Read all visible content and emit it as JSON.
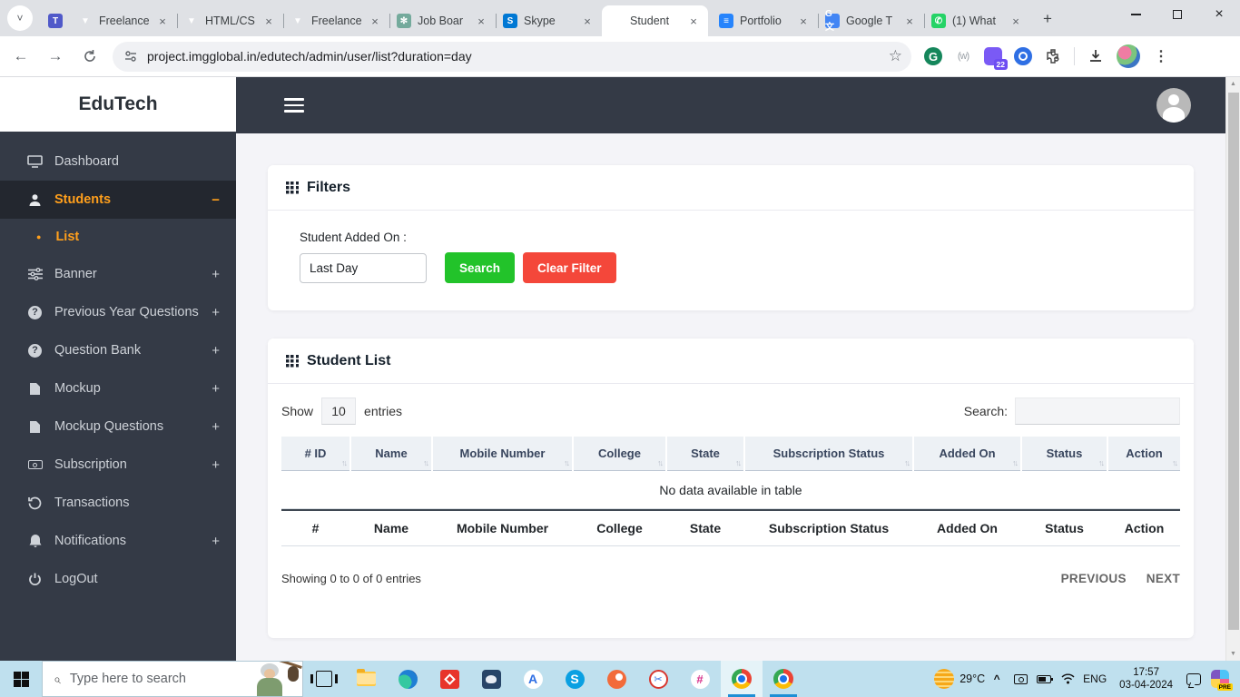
{
  "glyphs": {
    "close": "×",
    "plus": "+",
    "minus": "−",
    "back": "←",
    "forward": "→",
    "menu_dots": "⋮",
    "sort": "↑↓",
    "star": "☆",
    "chevron_down": "˅",
    "chevron_up": "^",
    "scroll_up": "▲",
    "scroll_down": "▼",
    "dot": "●",
    "magnifier": "⌕",
    "scissors": "✂",
    "hash": "#",
    "question": "?",
    "letter_g": "G",
    "letter_s": "S",
    "letter_a": "A",
    "translate_glyph": "G文",
    "wave": "(w)",
    "globe": "◍",
    "newtab": "+"
  },
  "browser": {
    "tabs": [
      {
        "label": "Freelance"
      },
      {
        "label": "HTML/CS"
      },
      {
        "label": "Freelance"
      },
      {
        "label": "Job Boar"
      },
      {
        "label": "Skype"
      },
      {
        "label": "Student"
      },
      {
        "label": "Portfolio"
      },
      {
        "label": "Google T"
      },
      {
        "label": "(1) What"
      }
    ],
    "url": "project.imgglobal.in/edutech/admin/user/list?duration=day",
    "extension_badge": "22"
  },
  "sidebar": {
    "brand": "EduTech",
    "items": [
      {
        "label": "Dashboard",
        "expander": ""
      },
      {
        "label": "Students",
        "expander": "−"
      },
      {
        "label": "List"
      },
      {
        "label": "Banner",
        "expander": "+"
      },
      {
        "label": "Previous Year Questions",
        "expander": "+"
      },
      {
        "label": "Question Bank",
        "expander": "+"
      },
      {
        "label": "Mockup",
        "expander": "+"
      },
      {
        "label": "Mockup Questions",
        "expander": "+"
      },
      {
        "label": "Subscription",
        "expander": "+"
      },
      {
        "label": "Transactions",
        "expander": ""
      },
      {
        "label": "Notifications",
        "expander": "+"
      },
      {
        "label": "LogOut",
        "expander": ""
      }
    ]
  },
  "filters": {
    "title": "Filters",
    "label": "Student Added On :",
    "select_value": "Last Day",
    "search_button": "Search",
    "clear_button": "Clear Filter"
  },
  "student_list": {
    "title": "Student List",
    "show_label": "Show",
    "entries_value": "10",
    "entries_label": "entries",
    "search_label": "Search:",
    "columns": [
      "# ID",
      "Name",
      "Mobile Number",
      "College",
      "State",
      "Subscription Status",
      "Added On",
      "Status",
      "Action"
    ],
    "footer_columns": [
      "#",
      "Name",
      "Mobile Number",
      "College",
      "State",
      "Subscription Status",
      "Added On",
      "Status",
      "Action"
    ],
    "empty_text": "No data available in table",
    "info": "Showing 0 to 0 of 0 entries",
    "prev_label": "PREVIOUS",
    "next_label": "NEXT"
  },
  "taskbar": {
    "search_placeholder": "Type here to search",
    "temperature": "29°C",
    "language": "ENG",
    "time": "17:57",
    "date": "03-04-2024",
    "copilot_badge": "PRE"
  },
  "colors": {
    "accent_orange": "#ff9f1c",
    "success_green": "#22c32a",
    "danger_red": "#f4473a",
    "sidebar_dark": "#343a46",
    "taskbar_blue": "#bfe0ee"
  }
}
